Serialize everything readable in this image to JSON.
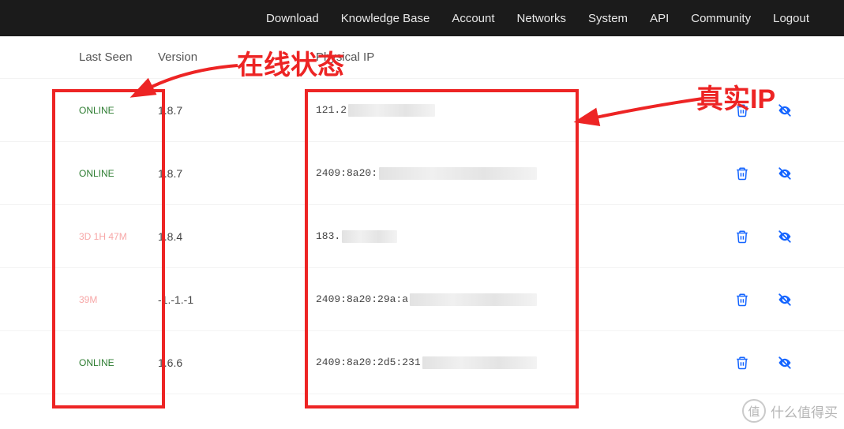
{
  "nav": {
    "download": "Download",
    "kb": "Knowledge Base",
    "account": "Account",
    "networks": "Networks",
    "system": "System",
    "api": "API",
    "community": "Community",
    "logout": "Logout"
  },
  "headers": {
    "last_seen": "Last Seen",
    "version": "Version",
    "physical_ip": "Physical IP"
  },
  "rows": [
    {
      "seen": "ONLINE",
      "seen_state": "online",
      "ver": "1.8.7",
      "ver_state": "ok",
      "ip_prefix": "121.2",
      "blur_w": 110
    },
    {
      "seen": "ONLINE",
      "seen_state": "online",
      "ver": "1.8.7",
      "ver_state": "ok",
      "ip_prefix": "2409:8a20:",
      "blur_w": 210
    },
    {
      "seen": "3D 1H 47M",
      "seen_state": "offline",
      "ver": "1.8.4",
      "ver_state": "ok",
      "ip_prefix": "183.",
      "blur_w": 70
    },
    {
      "seen": "39M",
      "seen_state": "offline",
      "ver": "-1.-1.-1",
      "ver_state": "bad",
      "ip_prefix": "2409:8a20:29a:a",
      "blur_w": 165
    },
    {
      "seen": "ONLINE",
      "seen_state": "online",
      "ver": "1.6.6",
      "ver_state": "ok",
      "ip_prefix": "2409:8a20:2d5:231",
      "blur_w": 175
    }
  ],
  "annotations": {
    "status_label": "在线状态",
    "ip_label": "真实IP"
  },
  "watermark": {
    "icon_text": "值",
    "text": "什么值得买"
  }
}
